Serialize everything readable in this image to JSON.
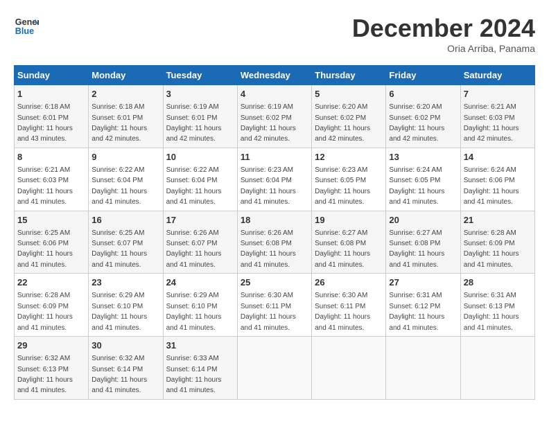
{
  "header": {
    "logo_line1": "General",
    "logo_line2": "Blue",
    "month": "December 2024",
    "location": "Oria Arriba, Panama"
  },
  "days_of_week": [
    "Sunday",
    "Monday",
    "Tuesday",
    "Wednesday",
    "Thursday",
    "Friday",
    "Saturday"
  ],
  "weeks": [
    [
      {
        "day": 1,
        "sunrise": "6:18 AM",
        "sunset": "6:01 PM",
        "daylight": "11 hours and 43 minutes."
      },
      {
        "day": 2,
        "sunrise": "6:18 AM",
        "sunset": "6:01 PM",
        "daylight": "11 hours and 42 minutes."
      },
      {
        "day": 3,
        "sunrise": "6:19 AM",
        "sunset": "6:01 PM",
        "daylight": "11 hours and 42 minutes."
      },
      {
        "day": 4,
        "sunrise": "6:19 AM",
        "sunset": "6:02 PM",
        "daylight": "11 hours and 42 minutes."
      },
      {
        "day": 5,
        "sunrise": "6:20 AM",
        "sunset": "6:02 PM",
        "daylight": "11 hours and 42 minutes."
      },
      {
        "day": 6,
        "sunrise": "6:20 AM",
        "sunset": "6:02 PM",
        "daylight": "11 hours and 42 minutes."
      },
      {
        "day": 7,
        "sunrise": "6:21 AM",
        "sunset": "6:03 PM",
        "daylight": "11 hours and 42 minutes."
      }
    ],
    [
      {
        "day": 8,
        "sunrise": "6:21 AM",
        "sunset": "6:03 PM",
        "daylight": "11 hours and 41 minutes."
      },
      {
        "day": 9,
        "sunrise": "6:22 AM",
        "sunset": "6:04 PM",
        "daylight": "11 hours and 41 minutes."
      },
      {
        "day": 10,
        "sunrise": "6:22 AM",
        "sunset": "6:04 PM",
        "daylight": "11 hours and 41 minutes."
      },
      {
        "day": 11,
        "sunrise": "6:23 AM",
        "sunset": "6:04 PM",
        "daylight": "11 hours and 41 minutes."
      },
      {
        "day": 12,
        "sunrise": "6:23 AM",
        "sunset": "6:05 PM",
        "daylight": "11 hours and 41 minutes."
      },
      {
        "day": 13,
        "sunrise": "6:24 AM",
        "sunset": "6:05 PM",
        "daylight": "11 hours and 41 minutes."
      },
      {
        "day": 14,
        "sunrise": "6:24 AM",
        "sunset": "6:06 PM",
        "daylight": "11 hours and 41 minutes."
      }
    ],
    [
      {
        "day": 15,
        "sunrise": "6:25 AM",
        "sunset": "6:06 PM",
        "daylight": "11 hours and 41 minutes."
      },
      {
        "day": 16,
        "sunrise": "6:25 AM",
        "sunset": "6:07 PM",
        "daylight": "11 hours and 41 minutes."
      },
      {
        "day": 17,
        "sunrise": "6:26 AM",
        "sunset": "6:07 PM",
        "daylight": "11 hours and 41 minutes."
      },
      {
        "day": 18,
        "sunrise": "6:26 AM",
        "sunset": "6:08 PM",
        "daylight": "11 hours and 41 minutes."
      },
      {
        "day": 19,
        "sunrise": "6:27 AM",
        "sunset": "6:08 PM",
        "daylight": "11 hours and 41 minutes."
      },
      {
        "day": 20,
        "sunrise": "6:27 AM",
        "sunset": "6:08 PM",
        "daylight": "11 hours and 41 minutes."
      },
      {
        "day": 21,
        "sunrise": "6:28 AM",
        "sunset": "6:09 PM",
        "daylight": "11 hours and 41 minutes."
      }
    ],
    [
      {
        "day": 22,
        "sunrise": "6:28 AM",
        "sunset": "6:09 PM",
        "daylight": "11 hours and 41 minutes."
      },
      {
        "day": 23,
        "sunrise": "6:29 AM",
        "sunset": "6:10 PM",
        "daylight": "11 hours and 41 minutes."
      },
      {
        "day": 24,
        "sunrise": "6:29 AM",
        "sunset": "6:10 PM",
        "daylight": "11 hours and 41 minutes."
      },
      {
        "day": 25,
        "sunrise": "6:30 AM",
        "sunset": "6:11 PM",
        "daylight": "11 hours and 41 minutes."
      },
      {
        "day": 26,
        "sunrise": "6:30 AM",
        "sunset": "6:11 PM",
        "daylight": "11 hours and 41 minutes."
      },
      {
        "day": 27,
        "sunrise": "6:31 AM",
        "sunset": "6:12 PM",
        "daylight": "11 hours and 41 minutes."
      },
      {
        "day": 28,
        "sunrise": "6:31 AM",
        "sunset": "6:13 PM",
        "daylight": "11 hours and 41 minutes."
      }
    ],
    [
      {
        "day": 29,
        "sunrise": "6:32 AM",
        "sunset": "6:13 PM",
        "daylight": "11 hours and 41 minutes."
      },
      {
        "day": 30,
        "sunrise": "6:32 AM",
        "sunset": "6:14 PM",
        "daylight": "11 hours and 41 minutes."
      },
      {
        "day": 31,
        "sunrise": "6:33 AM",
        "sunset": "6:14 PM",
        "daylight": "11 hours and 41 minutes."
      },
      null,
      null,
      null,
      null
    ]
  ]
}
